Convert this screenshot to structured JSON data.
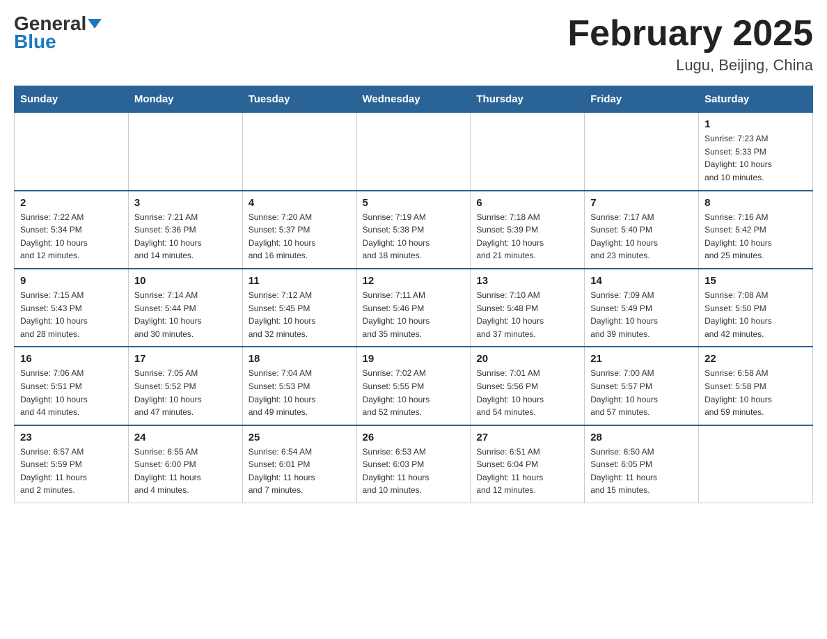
{
  "header": {
    "logo_line1": "General",
    "logo_line2": "Blue",
    "month_title": "February 2025",
    "location": "Lugu, Beijing, China"
  },
  "weekdays": [
    "Sunday",
    "Monday",
    "Tuesday",
    "Wednesday",
    "Thursday",
    "Friday",
    "Saturday"
  ],
  "weeks": [
    [
      {
        "day": "",
        "info": ""
      },
      {
        "day": "",
        "info": ""
      },
      {
        "day": "",
        "info": ""
      },
      {
        "day": "",
        "info": ""
      },
      {
        "day": "",
        "info": ""
      },
      {
        "day": "",
        "info": ""
      },
      {
        "day": "1",
        "info": "Sunrise: 7:23 AM\nSunset: 5:33 PM\nDaylight: 10 hours\nand 10 minutes."
      }
    ],
    [
      {
        "day": "2",
        "info": "Sunrise: 7:22 AM\nSunset: 5:34 PM\nDaylight: 10 hours\nand 12 minutes."
      },
      {
        "day": "3",
        "info": "Sunrise: 7:21 AM\nSunset: 5:36 PM\nDaylight: 10 hours\nand 14 minutes."
      },
      {
        "day": "4",
        "info": "Sunrise: 7:20 AM\nSunset: 5:37 PM\nDaylight: 10 hours\nand 16 minutes."
      },
      {
        "day": "5",
        "info": "Sunrise: 7:19 AM\nSunset: 5:38 PM\nDaylight: 10 hours\nand 18 minutes."
      },
      {
        "day": "6",
        "info": "Sunrise: 7:18 AM\nSunset: 5:39 PM\nDaylight: 10 hours\nand 21 minutes."
      },
      {
        "day": "7",
        "info": "Sunrise: 7:17 AM\nSunset: 5:40 PM\nDaylight: 10 hours\nand 23 minutes."
      },
      {
        "day": "8",
        "info": "Sunrise: 7:16 AM\nSunset: 5:42 PM\nDaylight: 10 hours\nand 25 minutes."
      }
    ],
    [
      {
        "day": "9",
        "info": "Sunrise: 7:15 AM\nSunset: 5:43 PM\nDaylight: 10 hours\nand 28 minutes."
      },
      {
        "day": "10",
        "info": "Sunrise: 7:14 AM\nSunset: 5:44 PM\nDaylight: 10 hours\nand 30 minutes."
      },
      {
        "day": "11",
        "info": "Sunrise: 7:12 AM\nSunset: 5:45 PM\nDaylight: 10 hours\nand 32 minutes."
      },
      {
        "day": "12",
        "info": "Sunrise: 7:11 AM\nSunset: 5:46 PM\nDaylight: 10 hours\nand 35 minutes."
      },
      {
        "day": "13",
        "info": "Sunrise: 7:10 AM\nSunset: 5:48 PM\nDaylight: 10 hours\nand 37 minutes."
      },
      {
        "day": "14",
        "info": "Sunrise: 7:09 AM\nSunset: 5:49 PM\nDaylight: 10 hours\nand 39 minutes."
      },
      {
        "day": "15",
        "info": "Sunrise: 7:08 AM\nSunset: 5:50 PM\nDaylight: 10 hours\nand 42 minutes."
      }
    ],
    [
      {
        "day": "16",
        "info": "Sunrise: 7:06 AM\nSunset: 5:51 PM\nDaylight: 10 hours\nand 44 minutes."
      },
      {
        "day": "17",
        "info": "Sunrise: 7:05 AM\nSunset: 5:52 PM\nDaylight: 10 hours\nand 47 minutes."
      },
      {
        "day": "18",
        "info": "Sunrise: 7:04 AM\nSunset: 5:53 PM\nDaylight: 10 hours\nand 49 minutes."
      },
      {
        "day": "19",
        "info": "Sunrise: 7:02 AM\nSunset: 5:55 PM\nDaylight: 10 hours\nand 52 minutes."
      },
      {
        "day": "20",
        "info": "Sunrise: 7:01 AM\nSunset: 5:56 PM\nDaylight: 10 hours\nand 54 minutes."
      },
      {
        "day": "21",
        "info": "Sunrise: 7:00 AM\nSunset: 5:57 PM\nDaylight: 10 hours\nand 57 minutes."
      },
      {
        "day": "22",
        "info": "Sunrise: 6:58 AM\nSunset: 5:58 PM\nDaylight: 10 hours\nand 59 minutes."
      }
    ],
    [
      {
        "day": "23",
        "info": "Sunrise: 6:57 AM\nSunset: 5:59 PM\nDaylight: 11 hours\nand 2 minutes."
      },
      {
        "day": "24",
        "info": "Sunrise: 6:55 AM\nSunset: 6:00 PM\nDaylight: 11 hours\nand 4 minutes."
      },
      {
        "day": "25",
        "info": "Sunrise: 6:54 AM\nSunset: 6:01 PM\nDaylight: 11 hours\nand 7 minutes."
      },
      {
        "day": "26",
        "info": "Sunrise: 6:53 AM\nSunset: 6:03 PM\nDaylight: 11 hours\nand 10 minutes."
      },
      {
        "day": "27",
        "info": "Sunrise: 6:51 AM\nSunset: 6:04 PM\nDaylight: 11 hours\nand 12 minutes."
      },
      {
        "day": "28",
        "info": "Sunrise: 6:50 AM\nSunset: 6:05 PM\nDaylight: 11 hours\nand 15 minutes."
      },
      {
        "day": "",
        "info": ""
      }
    ]
  ]
}
